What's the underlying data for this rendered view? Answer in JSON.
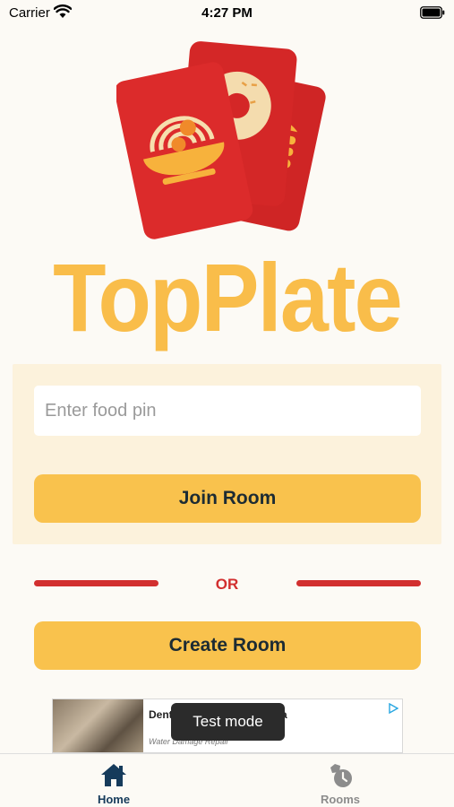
{
  "status_bar": {
    "carrier": "Carrier",
    "time": "4:27 PM"
  },
  "brand": {
    "name": "TopPlate"
  },
  "join": {
    "pin_placeholder": "Enter food pin",
    "join_label": "Join Room"
  },
  "divider": {
    "label": "OR"
  },
  "create": {
    "label": "Create Room"
  },
  "ad": {
    "title": "Dent Damage May Be Chea",
    "sponsor": "Water Damage Repair",
    "toast": "Test mode"
  },
  "tabs": [
    {
      "label": "Home",
      "icon": "home-icon",
      "active": true
    },
    {
      "label": "Rooms",
      "icon": "rooms-icon",
      "active": false
    }
  ],
  "colors": {
    "background": "#fcfaf5",
    "brand_yellow": "#f9bd4a",
    "button_yellow": "#f9c24d",
    "accent_red": "#d22f2f",
    "panel": "#fcf2dc",
    "tab_active": "#163b5b",
    "tab_inactive": "#8c8c8c"
  }
}
